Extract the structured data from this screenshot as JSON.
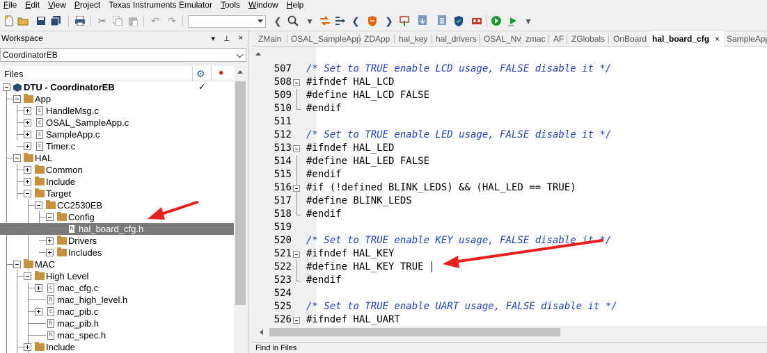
{
  "menu": [
    {
      "label": "File",
      "accel": "F",
      "rest": "ile"
    },
    {
      "label": "Edit",
      "accel": "E",
      "rest": "dit"
    },
    {
      "label": "View",
      "accel": "V",
      "rest": "iew"
    },
    {
      "label": "Project",
      "accel": "P",
      "rest": "roject"
    },
    {
      "label": "Texas Instruments Emulator",
      "accel": "",
      "rest": "Texas Instruments Emulator"
    },
    {
      "label": "Tools",
      "accel": "T",
      "rest": "ools"
    },
    {
      "label": "Window",
      "accel": "W",
      "rest": "indow"
    },
    {
      "label": "Help",
      "accel": "H",
      "rest": "elp"
    }
  ],
  "workspace": {
    "title": "Workspace",
    "pin": "▾",
    "pushpin": "⊥",
    "close": "×",
    "config": "CoordinatorEB",
    "files_header": "Files"
  },
  "tree": [
    {
      "label": "DTU - CoordinatorEB",
      "bold": true,
      "check": "✓"
    },
    {
      "label": "App"
    },
    {
      "label": "HandleMsg.c"
    },
    {
      "label": "OSAL_SampleApp.c"
    },
    {
      "label": "SampleApp.c"
    },
    {
      "label": "Timer.c"
    },
    {
      "label": "HAL"
    },
    {
      "label": "Common"
    },
    {
      "label": "Include"
    },
    {
      "label": "Target"
    },
    {
      "label": "CC2530EB"
    },
    {
      "label": "Config"
    },
    {
      "label": "hal_board_cfg.h"
    },
    {
      "label": "Drivers"
    },
    {
      "label": "Includes"
    },
    {
      "label": "MAC"
    },
    {
      "label": "High Level"
    },
    {
      "label": "mac_cfg.c"
    },
    {
      "label": "mac_high_level.h"
    },
    {
      "label": "mac_pib.c"
    },
    {
      "label": "mac_pib.h"
    },
    {
      "label": "mac_spec.h"
    },
    {
      "label": "Include"
    }
  ],
  "tabs": [
    {
      "label": "ZMain"
    },
    {
      "label": "OSAL_SampleApp"
    },
    {
      "label": "ZDApp"
    },
    {
      "label": "hal_key"
    },
    {
      "label": "hal_drivers"
    },
    {
      "label": "OSAL_Nv"
    },
    {
      "label": "zmac"
    },
    {
      "label": "AF"
    },
    {
      "label": "ZGlobals"
    },
    {
      "label": "OnBoard"
    },
    {
      "label": "hal_board_cfg",
      "close": "×"
    },
    {
      "label": "SampleApp"
    }
  ],
  "code": [
    {
      "n": "507",
      "t": "/* Set to TRUE enable LCD usage, FALSE disable it */"
    },
    {
      "n": "508",
      "t": "#ifndef HAL_LCD"
    },
    {
      "n": "509",
      "t": "#define HAL_LCD FALSE"
    },
    {
      "n": "510",
      "t": "#endif"
    },
    {
      "n": "511",
      "t": ""
    },
    {
      "n": "512",
      "t": "/* Set to TRUE enable LED usage, FALSE disable it */"
    },
    {
      "n": "513",
      "t": "#ifndef HAL_LED"
    },
    {
      "n": "514",
      "t": "#define HAL_LED FALSE"
    },
    {
      "n": "515",
      "t": "#endif"
    },
    {
      "n": "516",
      "t": "#if (!defined BLINK_LEDS) && (HAL_LED == TRUE)"
    },
    {
      "n": "517",
      "t": "#define BLINK_LEDS"
    },
    {
      "n": "518",
      "t": "#endif"
    },
    {
      "n": "519",
      "t": ""
    },
    {
      "n": "520",
      "t": "/* Set to TRUE enable KEY usage, FALSE disable it */"
    },
    {
      "n": "521",
      "t": "#ifndef HAL_KEY"
    },
    {
      "n": "522",
      "t": "#define HAL_KEY TRUE"
    },
    {
      "n": "523",
      "t": "#endif"
    },
    {
      "n": "524",
      "t": ""
    },
    {
      "n": "525",
      "t": "/* Set to TRUE enable UART usage, FALSE disable it */"
    },
    {
      "n": "526",
      "t": "#ifndef HAL_UART"
    }
  ],
  "find_bar": "Find in Files",
  "icons": {
    "file_c": "c",
    "file_h": "h"
  },
  "colors": {
    "comment": "#1f3fc4",
    "annotation": "#e8201e",
    "folder": "#c8923c",
    "selection": "#7a7a7a"
  }
}
